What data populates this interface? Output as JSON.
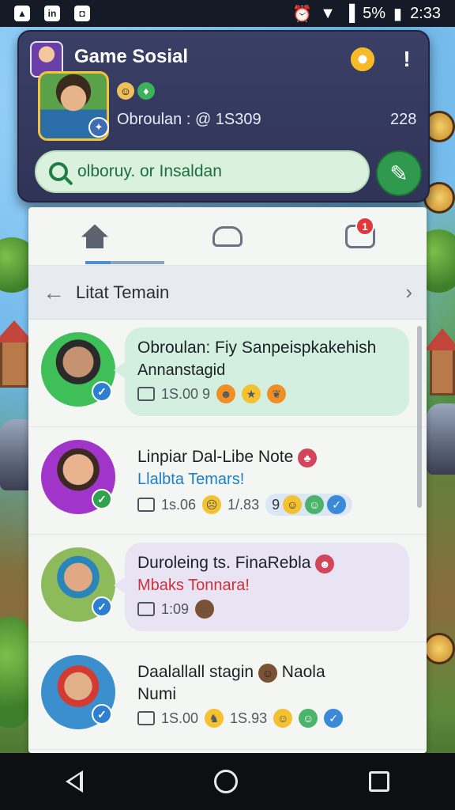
{
  "statusbar": {
    "left_icons": [
      "alert-icon",
      "ln-icon",
      "app-icon"
    ],
    "battery": "5%",
    "time": "2:33"
  },
  "header": {
    "title": "Game Sosial",
    "status_line": "Obroulan :  @  1S309",
    "count": "228",
    "search_placeholder": "olboruy. or Insaldan"
  },
  "tabs": [
    {
      "name": "home",
      "icon": "home-icon"
    },
    {
      "name": "cloud",
      "icon": "cloud-icon"
    },
    {
      "name": "games",
      "icon": "game-controller-icon",
      "badge": "1"
    }
  ],
  "section": {
    "title": "Litat Temain"
  },
  "items": [
    {
      "title_line1": "Obroulan:  Fiy Sanpeispkakehish",
      "title_line2": "Annanstagid",
      "meta": "1S.00 9",
      "verified": "blue",
      "bubble": "mint"
    },
    {
      "title_line1": "Linpiar Dal-Libe Note",
      "title_line2": "Llalbta Temars!",
      "meta_time": "1s.06",
      "meta_count": "1/.83",
      "pill_count": "9",
      "verified": "green"
    },
    {
      "title_line1": "Duroleing ts. FinaRebla",
      "title_line2": "Mbaks Tonnara!",
      "meta": "1:09",
      "verified": "blue",
      "bubble": "lav"
    },
    {
      "title_line1": "Daalallall stagin",
      "title_line1b": "Naola",
      "title_line2": "Numi",
      "meta_time": "1S.00",
      "meta_count": "1S.93",
      "verified": "blue"
    }
  ],
  "colors": {
    "header_bg": "#3a3f66",
    "accent_green": "#2f9a4d",
    "search_bg": "#d9f1dd",
    "notif_red": "#e2373b"
  }
}
